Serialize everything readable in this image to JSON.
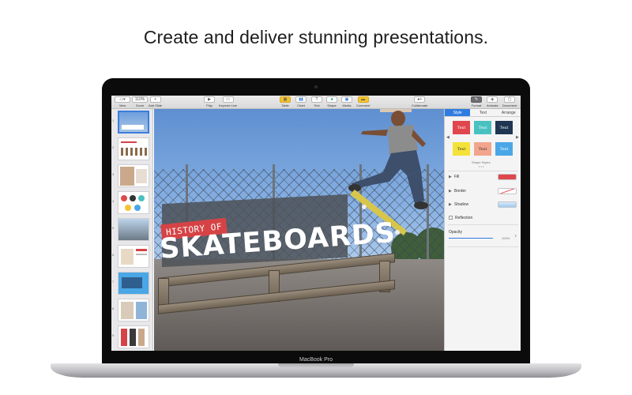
{
  "headline": "Create and deliver stunning presentations.",
  "device_label": "MacBook Pro",
  "toolbar": {
    "view": "View",
    "zoom": "Zoom",
    "zoom_value": "110%",
    "add_slide": "Add Slide",
    "play": "Play",
    "keynote_live": "Keynote Live",
    "table": "Table",
    "chart": "Chart",
    "text": "Text",
    "shape": "Shape",
    "media": "Media",
    "comment": "Comment",
    "collaborate": "Collaborate",
    "format": "Format",
    "animate": "Animate",
    "document": "Document"
  },
  "slide": {
    "tag_text": "HISTORY OF",
    "title": "SKATEBOARDS"
  },
  "navigator": {
    "slide_numbers": [
      "1",
      "2",
      "3",
      "4",
      "5",
      "6",
      "7",
      "8",
      "9"
    ]
  },
  "inspector": {
    "tabs": [
      "Style",
      "Text",
      "Arrange"
    ],
    "active_tab": "Style",
    "swatch_text": "Text",
    "swatches": [
      {
        "bg": "#e0474c",
        "fg": "#ffffff"
      },
      {
        "bg": "#49c1c0",
        "fg": "#ffffff"
      },
      {
        "bg": "#1f3552",
        "fg": "#ffffff"
      },
      {
        "bg": "#f4e23a",
        "fg": "#333333"
      },
      {
        "bg": "#f2a58c",
        "fg": "#333333"
      },
      {
        "bg": "#4aa7e6",
        "fg": "#ffffff"
      }
    ],
    "shape_styles_label": "Shape Styles",
    "fill": "Fill",
    "border": "Border",
    "shadow": "Shadow",
    "reflection": "Reflection",
    "opacity": "Opacity",
    "opacity_value": "100%"
  },
  "colors": {
    "accent": "#2f7ce0",
    "fill_color": "#e0474c",
    "tag_red": "#d64346"
  },
  "icons": [
    "view-icon",
    "plus-icon",
    "play-icon",
    "keynote-live-icon",
    "table-icon",
    "chart-icon",
    "text-icon",
    "shape-icon",
    "media-icon",
    "comment-icon",
    "collaborate-icon",
    "format-icon",
    "animate-icon",
    "document-icon"
  ]
}
